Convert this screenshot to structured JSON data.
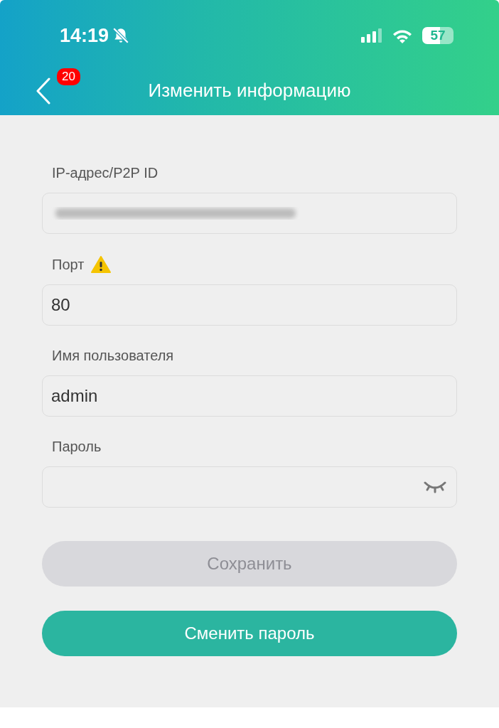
{
  "status_bar": {
    "time": "14:19",
    "muted": true,
    "battery": "57"
  },
  "header": {
    "title": "Изменить информацию",
    "back_badge": "20"
  },
  "fields": [
    {
      "kind": "text",
      "label": "IP-адрес/P2P ID",
      "redacted": true,
      "warning": false
    },
    {
      "kind": "text",
      "label": "Порт",
      "value": "80",
      "warning": true
    },
    {
      "kind": "text",
      "label": "Имя пользователя",
      "value": "admin",
      "warning": false
    },
    {
      "kind": "password",
      "label": "Пароль",
      "warning": false
    }
  ],
  "buttons": [
    {
      "label": "Сохранить",
      "disabled": true
    },
    {
      "label": "Сменить пароль",
      "disabled": false
    }
  ]
}
